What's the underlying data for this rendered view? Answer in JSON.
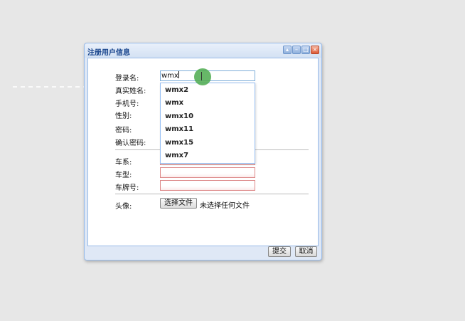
{
  "window": {
    "title": "注册用户信息"
  },
  "form": {
    "login_label": "登录名:",
    "login_value": "wmx",
    "realname_label": "真实姓名:",
    "phone_label": "手机号:",
    "gender_label": "性别:",
    "password_label": "密码:",
    "confirm_label": "确认密码:",
    "series_label": "车系:",
    "model_label": "车型:",
    "plate_label": "车牌号:",
    "avatar_label": "头像:",
    "choose_file_label": "选择文件",
    "file_status": "未选择任何文件"
  },
  "autocomplete": [
    "wmx2",
    "wmx",
    "wmx10",
    "wmx11",
    "wmx15",
    "wmx7"
  ],
  "buttons": {
    "submit": "提交",
    "cancel": "取消"
  },
  "icons": [
    "collapse-icon",
    "minimize-icon",
    "maximize-icon",
    "close-icon"
  ]
}
